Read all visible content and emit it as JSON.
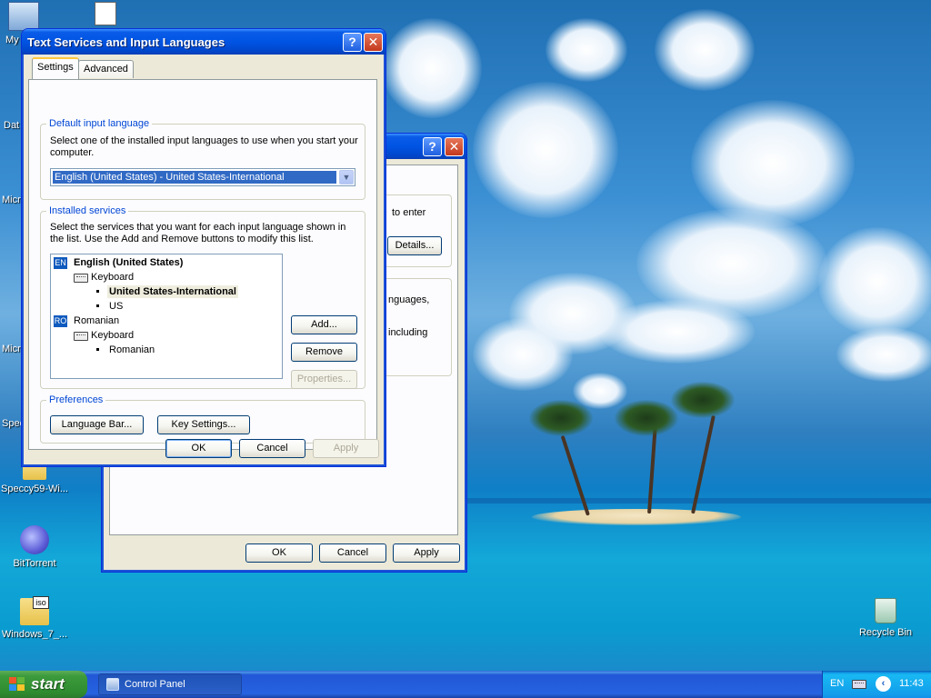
{
  "desktop": {
    "icons": [
      {
        "label": "My"
      },
      {
        "label": ""
      },
      {
        "label": "Dat"
      },
      {
        "label": "Micro C"
      },
      {
        "label": "Micro B"
      },
      {
        "label": "Spec"
      },
      {
        "label": "Speccy59-Wi..."
      },
      {
        "label": "BitTorrent"
      },
      {
        "label": "Windows_7_..."
      },
      {
        "label": "Recycle Bin"
      }
    ]
  },
  "back_window": {
    "help_button": "?",
    "close_button": "✕",
    "text_fragment_1": "to enter",
    "details_button": "Details...",
    "text_fragment_2": "nguages,",
    "text_fragment_3": "including",
    "ok_button": "OK",
    "cancel_button": "Cancel",
    "apply_button": "Apply"
  },
  "dialog": {
    "title": "Text Services and Input Languages",
    "help_button": "?",
    "close_button": "✕",
    "tabs": [
      {
        "label": "Settings",
        "active": true
      },
      {
        "label": "Advanced",
        "active": false
      }
    ],
    "default_language": {
      "legend": "Default input language",
      "description": "Select one of the installed input languages to use when you start your computer.",
      "selected": "English (United States) - United States-International"
    },
    "installed_services": {
      "legend": "Installed services",
      "description": "Select the services that you want for each input language shown in the list. Use the Add and Remove buttons to modify this list.",
      "tree": {
        "lang1_tag": "EN",
        "lang1_name": "English (United States)",
        "lang1_category": "Keyboard",
        "lang1_item1": "United States-International",
        "lang1_item2": "US",
        "lang2_tag": "RO",
        "lang2_name": "Romanian",
        "lang2_category": "Keyboard",
        "lang2_item1": "Romanian"
      },
      "add_button": "Add...",
      "remove_button": "Remove",
      "properties_button": "Properties..."
    },
    "preferences": {
      "legend": "Preferences",
      "language_bar_button": "Language Bar...",
      "key_settings_button": "Key Settings..."
    },
    "ok_button": "OK",
    "cancel_button": "Cancel",
    "apply_button": "Apply"
  },
  "taskbar": {
    "start_label": "start",
    "task_label": "Control Panel",
    "language_indicator": "EN",
    "clock": "11:43"
  }
}
